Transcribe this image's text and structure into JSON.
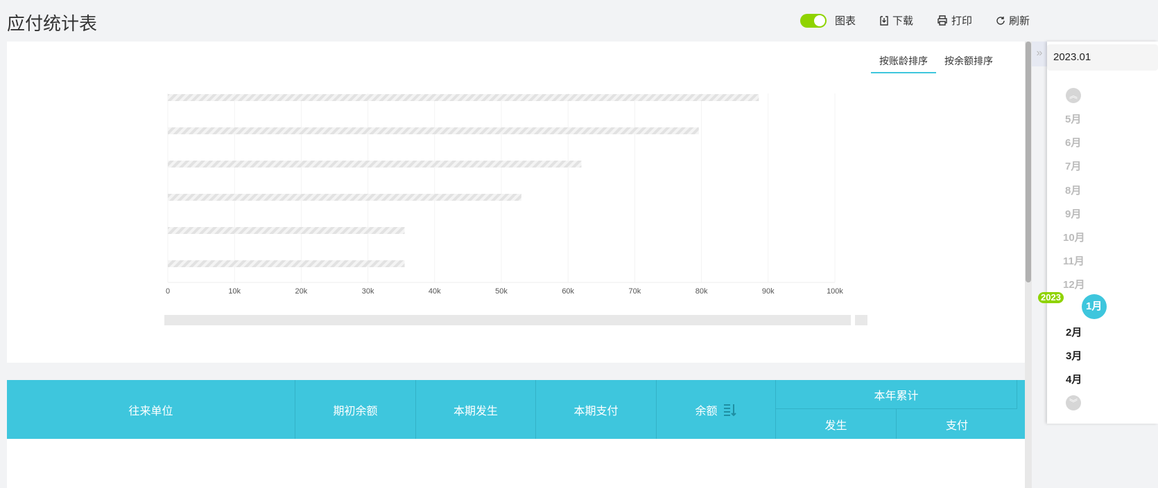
{
  "page": {
    "title": "应付统计表"
  },
  "toolbar": {
    "chart_toggle_label": "图表",
    "chart_toggle_on": true,
    "download": "下载",
    "print": "打印",
    "refresh": "刷新"
  },
  "sort_tabs": [
    {
      "label": "按账龄排序",
      "active": true
    },
    {
      "label": "按余额排序",
      "active": false
    }
  ],
  "chart_data": {
    "type": "bar",
    "orientation": "horizontal",
    "state": "loading-placeholder",
    "values": [
      88.6,
      79.6,
      62,
      53,
      35.5,
      35.5
    ],
    "x_tick_labels": [
      "0",
      "10k",
      "20k",
      "30k",
      "40k",
      "50k",
      "60k",
      "70k",
      "80k",
      "90k",
      "100k"
    ],
    "xlim": [
      0,
      100
    ],
    "grid": true,
    "bar_color": "#e8e8e8"
  },
  "table": {
    "headers": {
      "company": "往来单位",
      "opening": "期初余额",
      "current_occur": "本期发生",
      "current_pay": "本期支付",
      "balance": "余额",
      "ytd": "本年累计",
      "ytd_occur": "发生",
      "ytd_pay": "支付"
    },
    "color": "#3ec6dd"
  },
  "sidebar": {
    "date_value": "2023.01",
    "year_badge": "2023",
    "months_prev": [
      "5月",
      "6月",
      "7月",
      "8月",
      "9月",
      "10月",
      "11月",
      "12月"
    ],
    "selected": "1月",
    "months_next": [
      "2月",
      "3月",
      "4月"
    ]
  }
}
